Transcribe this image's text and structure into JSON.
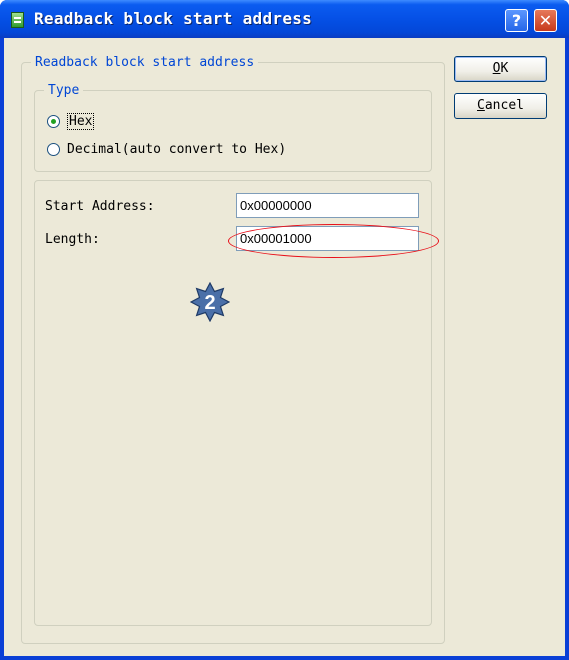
{
  "window": {
    "title": "Readback block start address",
    "help_glyph": "?",
    "close_glyph": "✕"
  },
  "group": {
    "legend": "Readback block start address"
  },
  "type_group": {
    "legend": "Type",
    "options": [
      {
        "label": "Hex",
        "selected": true
      },
      {
        "label": "Decimal(auto convert to Hex)",
        "selected": false
      }
    ]
  },
  "fields": {
    "start_address": {
      "label": "Start Address:",
      "value": "0x00000000"
    },
    "length": {
      "label": "Length:",
      "value": "0x00001000"
    }
  },
  "buttons": {
    "ok": {
      "mnemonic": "O",
      "rest": "K"
    },
    "cancel": {
      "mnemonic": "C",
      "rest": "ancel"
    }
  },
  "annotation": {
    "step_number": "2",
    "highlight_color": "#e8101a",
    "badge_color": "#4a6fa8"
  },
  "icons": [
    "app-icon",
    "help-icon",
    "close-icon",
    "radio-checked-icon",
    "radio-unchecked-icon",
    "step-badge-icon"
  ]
}
